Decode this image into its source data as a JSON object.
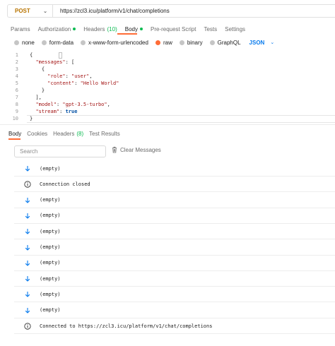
{
  "request": {
    "method": "POST",
    "url": "https://zcl3.icu/platform/v1/chat/completions"
  },
  "request_tabs": [
    {
      "label": "Params"
    },
    {
      "label": "Authorization",
      "dot": true
    },
    {
      "label": "Headers",
      "count": "(10)"
    },
    {
      "label": "Body",
      "dot": true,
      "active": true
    },
    {
      "label": "Pre-request Script"
    },
    {
      "label": "Tests"
    },
    {
      "label": "Settings"
    }
  ],
  "body_types": [
    {
      "label": "none"
    },
    {
      "label": "form-data"
    },
    {
      "label": "x-www-form-urlencoded"
    },
    {
      "label": "raw",
      "selected": true
    },
    {
      "label": "binary"
    },
    {
      "label": "GraphQL"
    }
  ],
  "body_format": "JSON",
  "editor": {
    "line_numbers": [
      "1",
      "2",
      "3",
      "4",
      "5",
      "6",
      "7",
      "8",
      "9",
      "10"
    ],
    "lines": [
      "{",
      "  \"messages\": [",
      "    {",
      "      \"role\": \"user\",",
      "      \"content\": \"Hello World\"",
      "    }",
      "  ],",
      "  \"model\": \"gpt-3.5-turbo\",",
      "  \"stream\": true",
      "}"
    ]
  },
  "response_tabs": [
    {
      "label": "Body",
      "active": true
    },
    {
      "label": "Cookies"
    },
    {
      "label": "Headers",
      "count": "(8)"
    },
    {
      "label": "Test Results"
    }
  ],
  "search": {
    "placeholder": "Search"
  },
  "clear_label": "Clear Messages",
  "messages": [
    {
      "icon": "arrow-down-icon",
      "text": "(empty)"
    },
    {
      "icon": "info-icon",
      "text": "Connection closed"
    },
    {
      "icon": "arrow-down-icon",
      "text": "(empty)"
    },
    {
      "icon": "arrow-down-icon",
      "text": "(empty)"
    },
    {
      "icon": "arrow-down-icon",
      "text": "(empty)"
    },
    {
      "icon": "arrow-down-icon",
      "text": "(empty)"
    },
    {
      "icon": "arrow-down-icon",
      "text": "(empty)"
    },
    {
      "icon": "arrow-down-icon",
      "text": "(empty)"
    },
    {
      "icon": "arrow-down-icon",
      "text": "(empty)"
    },
    {
      "icon": "arrow-down-icon",
      "text": "(empty)"
    },
    {
      "icon": "info-icon",
      "text": "Connected to https://zcl3.icu/platform/v1/chat/completions"
    }
  ],
  "colors": {
    "accent": "#ff6c37",
    "method": "#b87400",
    "status_dot": "#0cbb52",
    "link": "#097bed",
    "arrow": "#097bed"
  }
}
